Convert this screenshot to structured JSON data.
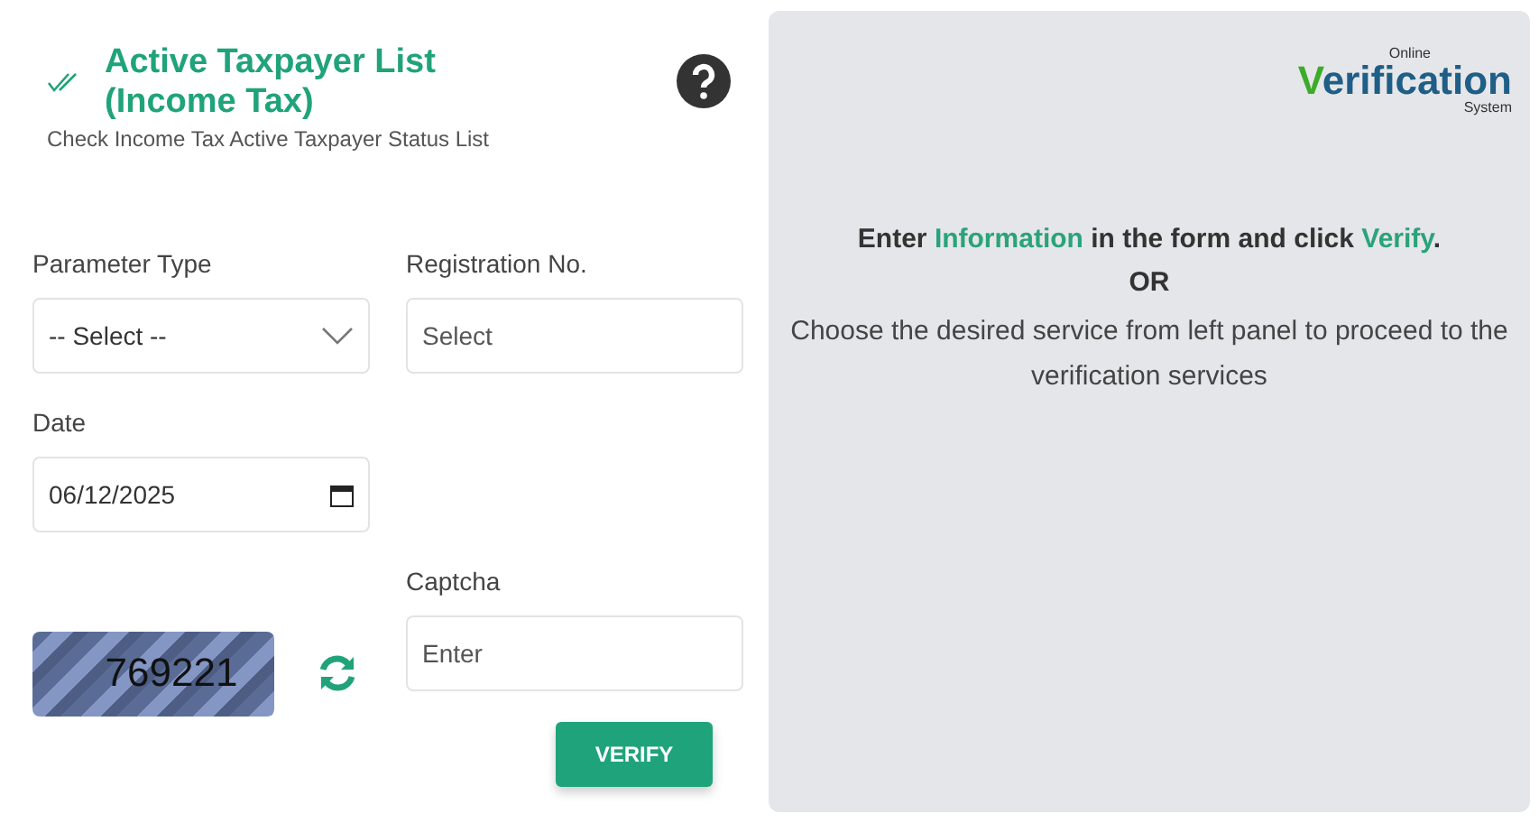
{
  "header": {
    "title": "Active Taxpayer List (Income Tax)",
    "subtitle": "Check Income Tax Active Taxpayer Status List"
  },
  "form": {
    "parameter_type": {
      "label": "Parameter Type",
      "value": "-- Select --"
    },
    "registration_no": {
      "label": "Registration No.",
      "placeholder": "Select"
    },
    "date": {
      "label": "Date",
      "value": "06/12/2025"
    },
    "captcha": {
      "code": "769221",
      "label": "Captcha",
      "placeholder": "Enter"
    },
    "verify_button": "VERIFY"
  },
  "info_panel": {
    "logo": {
      "top": "Online",
      "initial": "V",
      "main": "erification",
      "bottom": "System"
    },
    "instruction": [
      {
        "text": "Enter ",
        "highlight": false
      },
      {
        "text": "Information",
        "highlight": true
      },
      {
        "text": " in the form and click ",
        "highlight": false
      },
      {
        "text": "Verify",
        "highlight": true
      },
      {
        "text": ".",
        "highlight": false
      }
    ],
    "separator": "OR",
    "note": "Choose the desired service from left panel to proceed to the verification services"
  }
}
